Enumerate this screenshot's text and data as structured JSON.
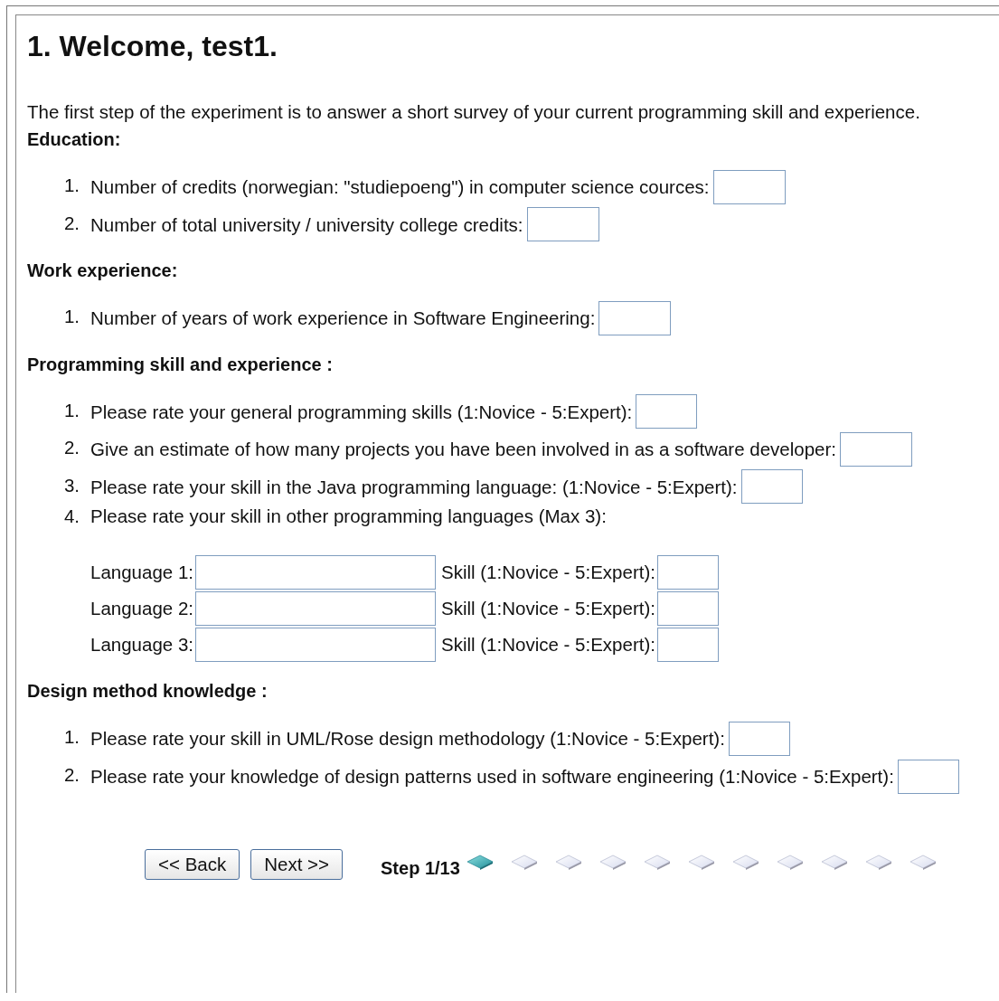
{
  "heading": "1. Welcome, test1.",
  "intro": "The first step of the experiment is to answer a short survey of your current programming skill and experience.",
  "sections": [
    {
      "title": "Education:",
      "questions": [
        {
          "kind": "wide",
          "number": "1.",
          "label": "Number of credits (norwegian: \"studiepoeng\") in computer science cources:"
        },
        {
          "kind": "wide",
          "number": "2.",
          "label": "Number of total university / university college credits:"
        }
      ]
    },
    {
      "title": "Work experience:",
      "questions": [
        {
          "kind": "wide",
          "number": "1.",
          "label": "Number of years of work experience in Software Engineering:"
        }
      ]
    },
    {
      "title": "Programming skill and experience :",
      "questions": [
        {
          "kind": "narrow",
          "number": "1.",
          "label": "Please rate your general programming skills (1:Novice - 5:Expert):"
        },
        {
          "kind": "wide",
          "number": "2.",
          "label": "Give an estimate of how many projects you have been involved in as a software developer:"
        },
        {
          "kind": "narrow",
          "number": "3.",
          "label": "Please rate your skill in the Java programming language: (1:Novice - 5:Expert):"
        },
        {
          "kind": "languages",
          "number": "4.",
          "label": "Please rate your skill in other programming languages (Max 3):",
          "rows": [
            {
              "language_label": "Language 1:",
              "skill_label": "Skill (1:Novice - 5:Expert):"
            },
            {
              "language_label": "Language 2:",
              "skill_label": "Skill (1:Novice - 5:Expert):"
            },
            {
              "language_label": "Language 3:",
              "skill_label": "Skill (1:Novice - 5:Expert):"
            }
          ]
        }
      ]
    },
    {
      "title": "Design method knowledge :",
      "questions": [
        {
          "kind": "narrow",
          "number": "1.",
          "label": "Please rate your skill in UML/Rose design methodology (1:Novice - 5:Expert):"
        },
        {
          "kind": "narrow",
          "number": "2.",
          "label": "Please rate your knowledge of design patterns used in software engineering (1:Novice - 5:Expert):"
        }
      ]
    }
  ],
  "buttons": [
    "<< Back",
    "Next >>"
  ],
  "step_label": "Step 1/13",
  "steps": [
    {
      "selected": true
    },
    {
      "selected": false
    },
    {
      "selected": false
    },
    {
      "selected": false
    },
    {
      "selected": false
    },
    {
      "selected": false
    },
    {
      "selected": false
    },
    {
      "selected": false
    },
    {
      "selected": false
    },
    {
      "selected": false
    },
    {
      "selected": false
    }
  ]
}
